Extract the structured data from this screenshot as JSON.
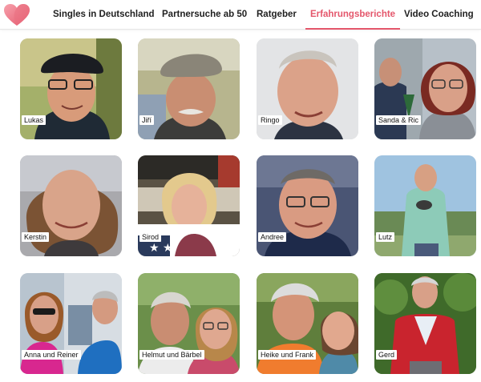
{
  "header": {
    "logo_icon": "heart-logo-icon",
    "nav": [
      {
        "label": "Singles in Deutschland",
        "active": false
      },
      {
        "label": "Partnersuche ab 50",
        "active": false
      },
      {
        "label": "Ratgeber",
        "active": false
      },
      {
        "label": "Erfahrungsberichte",
        "active": true
      },
      {
        "label": "Video Coaching",
        "active": false
      }
    ]
  },
  "colors": {
    "accent": "#e4566b",
    "text": "#1f1f1f"
  },
  "testimonials": [
    {
      "name": "Lukas"
    },
    {
      "name": "Jiří"
    },
    {
      "name": "Ringo"
    },
    {
      "name": "Sanda & Ric"
    },
    {
      "name": "Kerstin"
    },
    {
      "name": "Sirod"
    },
    {
      "name": "Andree"
    },
    {
      "name": "Lutz"
    },
    {
      "name": "Anna und Reiner"
    },
    {
      "name": "Helmut und Bärbel"
    },
    {
      "name": "Heike und Frank"
    },
    {
      "name": "Gerd"
    }
  ]
}
